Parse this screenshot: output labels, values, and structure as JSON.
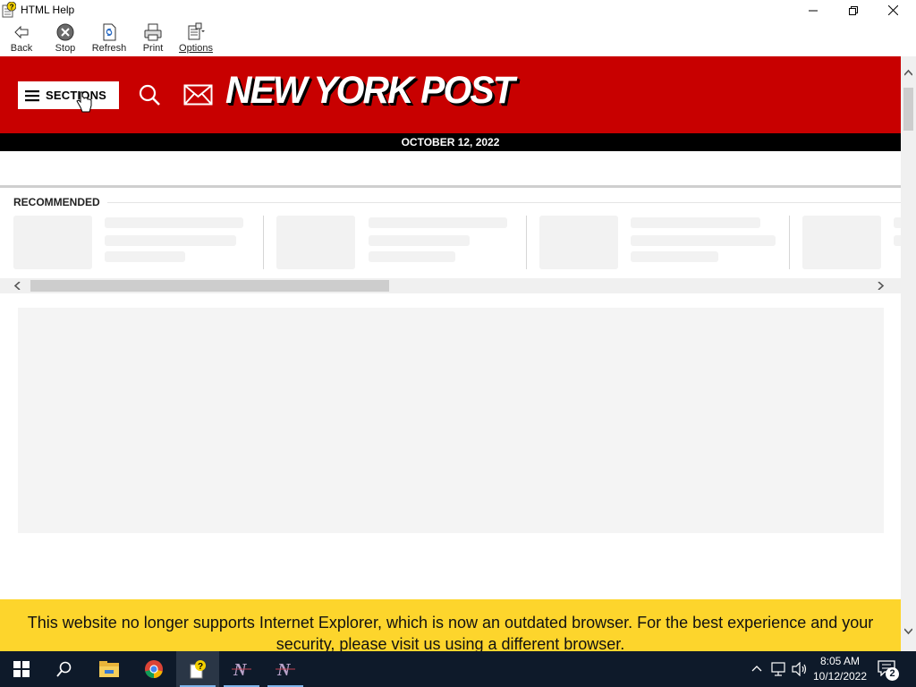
{
  "window": {
    "title": "HTML Help"
  },
  "toolbar": {
    "back_label": "Back",
    "stop_label": "Stop",
    "refresh_label": "Refresh",
    "print_label": "Print",
    "options_label": "Options"
  },
  "site": {
    "sections_label": "SECTIONS",
    "logo_text": "NEW YORK POST",
    "date": "OCTOBER 12, 2022",
    "recommended_label": "RECOMMENDED",
    "banner_text": "This website no longer supports Internet Explorer, which is now an outdated browser. For the best experience and your security, please visit us using a different browser.",
    "brand_color": "#c80000",
    "banner_color": "#fdd52c"
  },
  "taskbar": {
    "time": "8:05 AM",
    "date": "10/12/2022",
    "notification_count": "2",
    "apps": [
      "start-icon",
      "search-icon",
      "file-explorer-icon",
      "chrome-icon",
      "html-help-icon",
      "app-n-icon",
      "app-n-icon"
    ]
  }
}
